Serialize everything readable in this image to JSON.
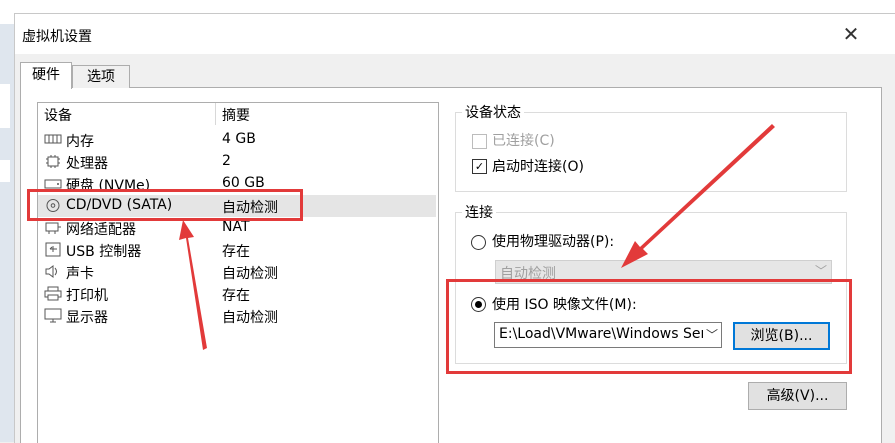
{
  "window": {
    "title": "虚拟机设置",
    "close_glyph": "✕"
  },
  "tabs": [
    {
      "label": "硬件"
    },
    {
      "label": "选项"
    }
  ],
  "device_list": {
    "columns": [
      "设备",
      "摘要"
    ],
    "rows": [
      {
        "icon": "memory-icon",
        "name": "内存",
        "summary": "4 GB"
      },
      {
        "icon": "cpu-icon",
        "name": "处理器",
        "summary": "2"
      },
      {
        "icon": "disk-icon",
        "name": "硬盘 (NVMe)",
        "summary": "60 GB"
      },
      {
        "icon": "cd-dvd-icon",
        "name": "CD/DVD (SATA)",
        "summary": "自动检测"
      },
      {
        "icon": "network-icon",
        "name": "网络适配器",
        "summary": "NAT"
      },
      {
        "icon": "usb-icon",
        "name": "USB 控制器",
        "summary": "存在"
      },
      {
        "icon": "sound-icon",
        "name": "声卡",
        "summary": "自动检测"
      },
      {
        "icon": "printer-icon",
        "name": "打印机",
        "summary": "存在"
      },
      {
        "icon": "display-icon",
        "name": "显示器",
        "summary": "自动检测"
      }
    ]
  },
  "device_status": {
    "group_label": "设备状态",
    "connected": {
      "label": "已连接(C)",
      "checked": false,
      "enabled": false
    },
    "connect_at_power_on": {
      "label": "启动时连接(O)",
      "checked": true,
      "enabled": true
    }
  },
  "connection": {
    "group_label": "连接",
    "physical_drive": {
      "label": "使用物理驱动器(P):",
      "selected": false,
      "combo_value": "自动检测"
    },
    "iso_image": {
      "label": "使用 ISO 映像文件(M):",
      "selected": true,
      "path": "E:\\Load\\VMware\\Windows Ser"
    },
    "browse_label": "浏览(B)...",
    "advanced_label": "高级(V)..."
  },
  "colors": {
    "highlight_red": "#e23a3a",
    "focus_blue": "#0078d7"
  }
}
